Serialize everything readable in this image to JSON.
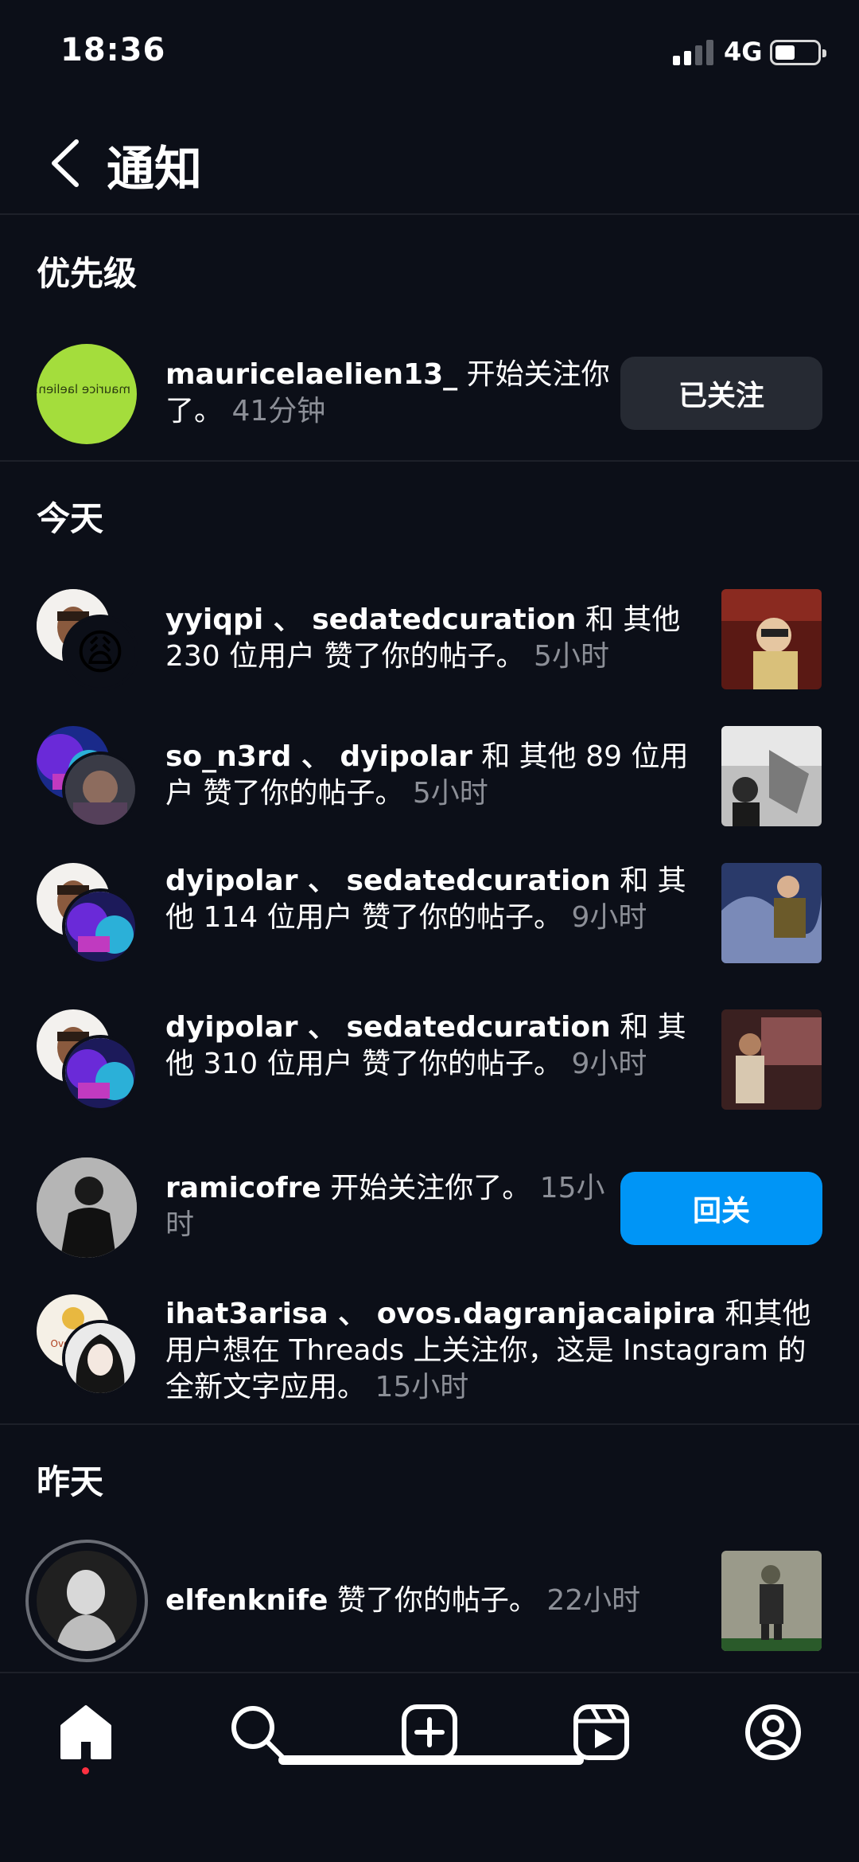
{
  "status_bar": {
    "time": "18:36",
    "network": "4G"
  },
  "header": {
    "title": "通知"
  },
  "sections": {
    "priority": "优先级",
    "today": "今天",
    "yesterday": "昨天"
  },
  "priority": {
    "user": "mauricelaelien13_",
    "action": " 开始关注你了。 ",
    "time": "41分钟",
    "button": "已关注",
    "avatar_text": "maurice laelien13"
  },
  "today": [
    {
      "users": "yyiqpi 、 sedatedcuration",
      "action": " 和 其他 230 位用户 赞了你的帖子。 ",
      "time": "5小时"
    },
    {
      "users": "so_n3rd 、 dyipolar",
      "action": " 和 其他 89 位用户 赞了你的帖子。 ",
      "time": "5小时"
    },
    {
      "users": "dyipolar 、 sedatedcuration",
      "action": " 和 其他 114 位用户 赞了你的帖子。 ",
      "time": "9小时"
    },
    {
      "users": "dyipolar 、 sedatedcuration",
      "action": " 和 其他 310 位用户 赞了你的帖子。 ",
      "time": "9小时"
    },
    {
      "users": "ramicofre",
      "action": " 开始关注你了。 ",
      "time": "15小时",
      "button": "回关"
    },
    {
      "users": "ihat3arisa 、 ovos.dagranjacaipira",
      "action": " 和其他用户想在 Threads 上关注你，这是 Instagram 的全新文字应用。 ",
      "time": "15小时",
      "avatar_text": "Ovos tipo"
    }
  ],
  "yesterday": [
    {
      "users": "elfenknife",
      "action": " 赞了你的帖子。 ",
      "time": "22小时"
    }
  ],
  "emoji": "😩",
  "nav": [
    "home-icon",
    "search-icon",
    "create-icon",
    "reels-icon",
    "profile-icon"
  ],
  "colors": {
    "background": "#0c0f18",
    "accent": "#0095f6",
    "muted": "#8c8f97",
    "button_gray": "#262a33",
    "dot": "#ff3040"
  }
}
